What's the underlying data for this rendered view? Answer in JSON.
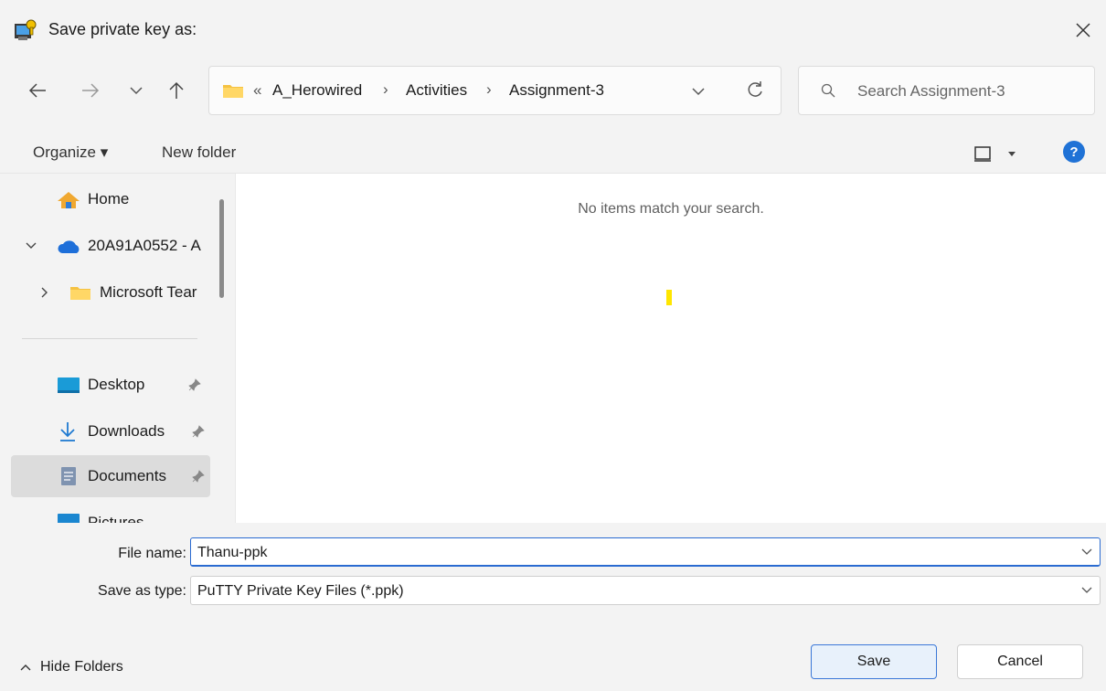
{
  "window": {
    "title": "Save private key as:"
  },
  "nav": {
    "breadcrumb": {
      "overflow": "«",
      "parts": [
        "A_Herowired",
        "Activities",
        "Assignment-3"
      ],
      "separator": "›"
    },
    "search": {
      "placeholder": "Search Assignment-3"
    }
  },
  "cmdbar": {
    "organize": "Organize ▾",
    "new_folder": "New folder",
    "help": "?"
  },
  "sidebar": {
    "items": [
      {
        "label": "Home"
      },
      {
        "label": "20A91A0552 - A"
      },
      {
        "label": "Microsoft Tear"
      },
      {
        "label": "Desktop"
      },
      {
        "label": "Downloads"
      },
      {
        "label": "Documents"
      },
      {
        "label": "Pictures"
      }
    ],
    "selected": "Documents"
  },
  "content": {
    "empty_message": "No items match your search."
  },
  "form": {
    "filename_label": "File name:",
    "filename_value": "Thanu-ppk",
    "type_label": "Save as type:",
    "type_value": "PuTTY Private Key Files (*.ppk)"
  },
  "footer": {
    "hide_folders": "Hide Folders",
    "save": "Save",
    "cancel": "Cancel"
  },
  "colors": {
    "accent": "#2a6bd1",
    "folder": "#f5c242",
    "onedrive": "#1e6fd9",
    "help": "#1f72d6"
  }
}
